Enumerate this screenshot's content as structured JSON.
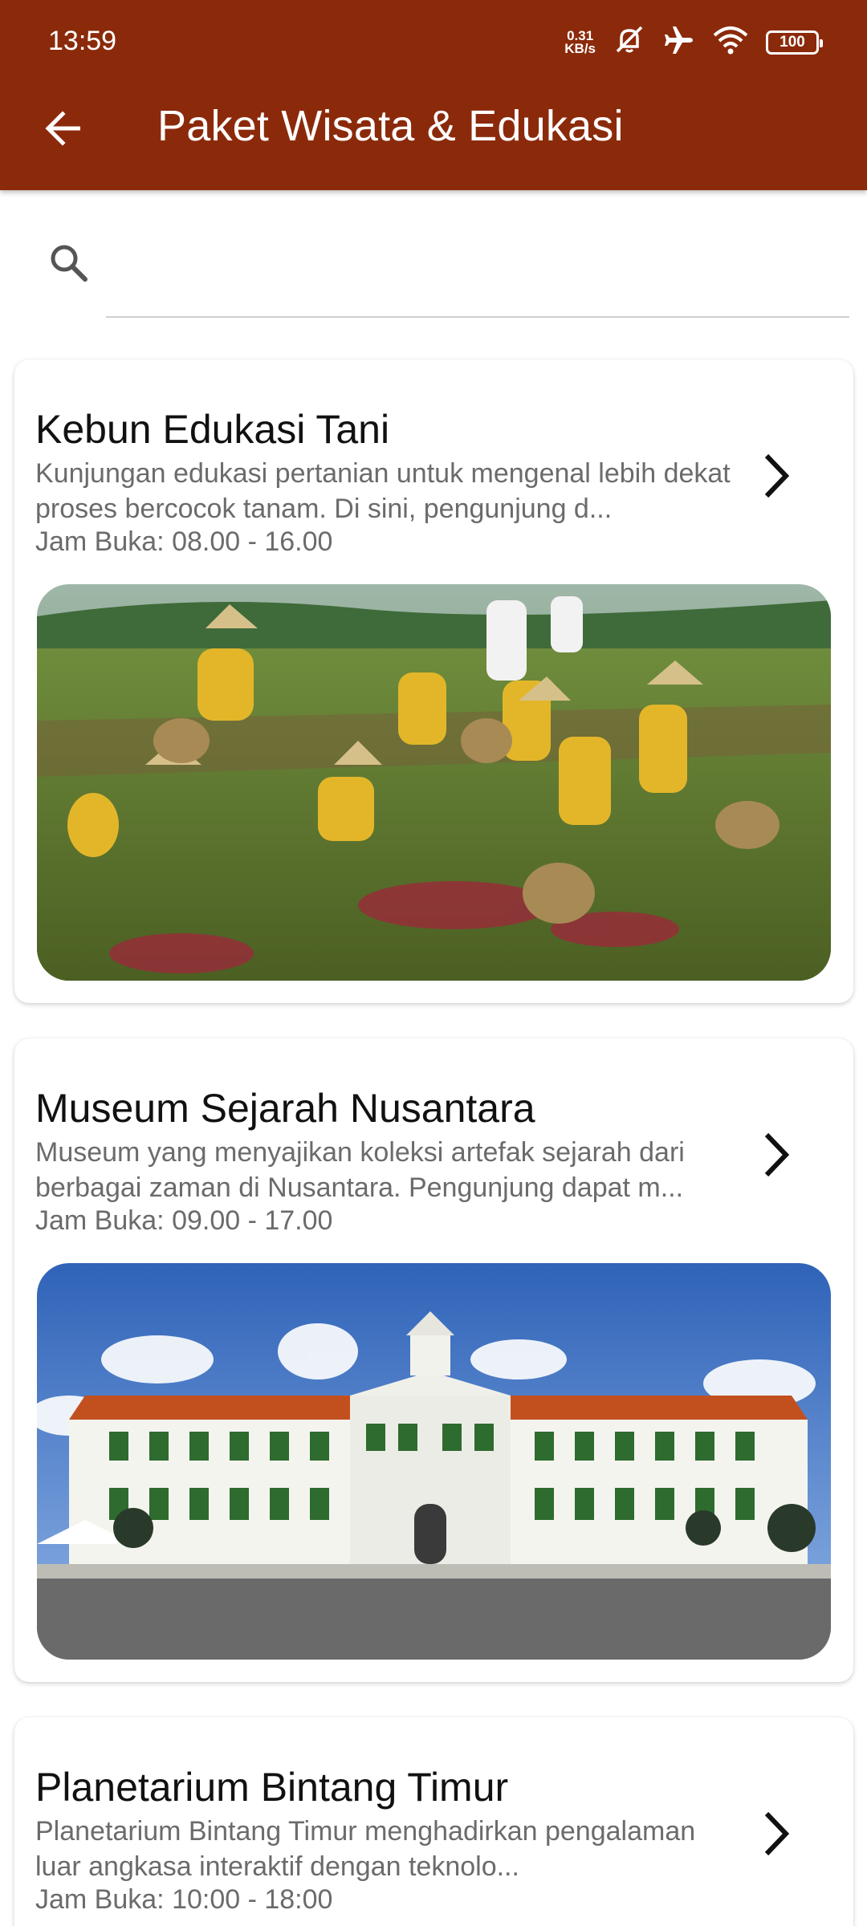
{
  "status_bar": {
    "time": "13:59",
    "net_speed_value": "0.31",
    "net_speed_unit": "KB/s",
    "battery": "100",
    "icons": [
      "mute-icon",
      "airplane-icon",
      "wifi-icon",
      "battery-icon"
    ]
  },
  "app_bar": {
    "title": "Paket Wisata & Edukasi",
    "back_icon": "arrow-left-icon",
    "color": "#8b2a0b"
  },
  "search": {
    "icon": "search-icon",
    "value": "",
    "placeholder": ""
  },
  "places": [
    {
      "name": "Kebun Edukasi Tani",
      "description": "Kunjungan edukasi pertanian untuk mengenal lebih dekat proses bercocok tanam. Di sini, pengunjung d...",
      "hours": "Jam Buka: 08.00 - 16.00",
      "image": "children-in-farm-field"
    },
    {
      "name": "Museum Sejarah Nusantara",
      "description": "Museum yang menyajikan koleksi artefak sejarah dari berbagai zaman di Nusantara. Pengunjung dapat m...",
      "hours": "Jam Buka: 09.00 - 17.00",
      "image": "colonial-museum-building"
    },
    {
      "name": "Planetarium Bintang Timur",
      "description": "Planetarium Bintang Timur menghadirkan pengalaman luar angkasa interaktif dengan teknolo...",
      "hours": "Jam Buka: 10:00 - 18:00",
      "image": ""
    }
  ]
}
